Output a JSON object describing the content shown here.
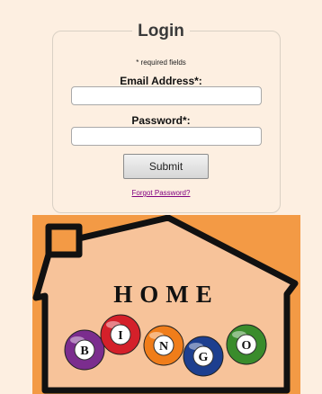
{
  "login": {
    "title": "Login",
    "required_note": "* required fields",
    "email_label": "Email Address*:",
    "email_value": "",
    "password_label": "Password*:",
    "password_value": "",
    "submit_label": "Submit",
    "forgot_label": "Forgot Password?"
  },
  "logo": {
    "word": "HOME",
    "balls": [
      {
        "letter": "B",
        "color": "#7b2d8e"
      },
      {
        "letter": "I",
        "color": "#d4202a"
      },
      {
        "letter": "N",
        "color": "#f07d1a"
      },
      {
        "letter": "G",
        "color": "#1d3f8f"
      },
      {
        "letter": "O",
        "color": "#3a8c2c"
      }
    ],
    "background_color": "#f39a45",
    "house_fill": "#f7c39a"
  },
  "colors": {
    "page_background": "#fdefe1",
    "link_color": "#800080"
  }
}
